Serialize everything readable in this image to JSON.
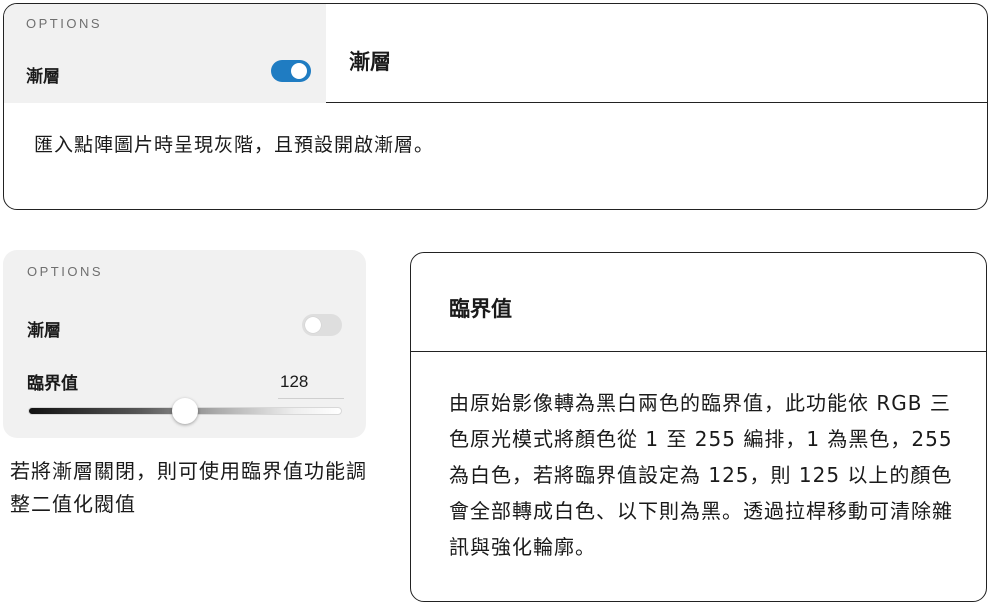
{
  "card1": {
    "options_label": "OPTIONS",
    "gradient_label": "漸層",
    "gradient_toggle_on": true,
    "title": "漸層",
    "description": "匯入點陣圖片時呈現灰階，且預設開啟漸層。"
  },
  "panel2": {
    "options_label": "OPTIONS",
    "gradient_label": "漸層",
    "gradient_toggle_on": false,
    "threshold_label": "臨界值",
    "threshold_value": "128",
    "slider_fraction": 0.5
  },
  "caption": "若將漸層關閉，則可使用臨界值功能調整二值化閥值",
  "card3": {
    "title": "臨界值",
    "description": "由原始影像轉為黑白兩色的臨界值，此功能依 RGB 三色原光模式將顏色從 1 至 255 編排，1 為黑色，255 為白色，若將臨界值設定為 125，則 125 以上的顏色會全部轉成白色、以下則為黑。透過拉桿移動可清除雜訊與強化輪廓。"
  },
  "colors": {
    "toggle_on": "#1f7cc2",
    "toggle_off": "#dedede",
    "panel_bg": "#f1f1f1"
  }
}
